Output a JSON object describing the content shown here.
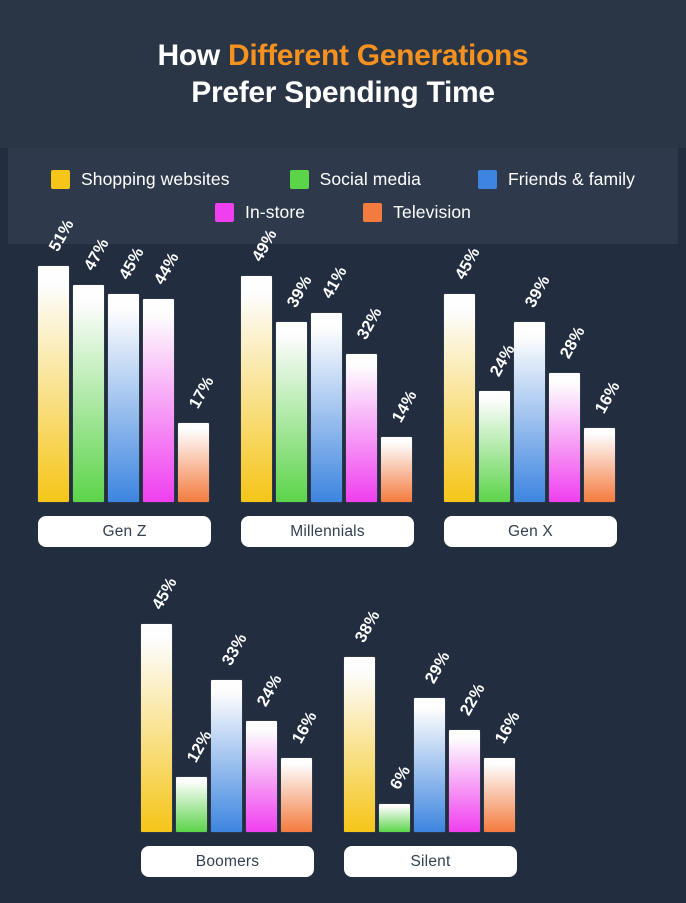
{
  "header": {
    "title_part1": "How ",
    "title_accent": "Different Generations",
    "title_line2": "Prefer Spending Time"
  },
  "legend": {
    "items": [
      {
        "label": "Shopping websites",
        "color": "#f5c518"
      },
      {
        "label": "Social media",
        "color": "#5cd44a"
      },
      {
        "label": "Friends & family",
        "color": "#3d85e0"
      },
      {
        "label": "In-store",
        "color": "#f03fef"
      },
      {
        "label": "Television",
        "color": "#f47b3f"
      }
    ]
  },
  "chart_data": {
    "type": "bar",
    "title": "How Different Generations Prefer Spending Time",
    "xlabel": "",
    "ylabel": "",
    "ylim": [
      0,
      55
    ],
    "grid": false,
    "legend_position": "top",
    "value_suffix": "%",
    "categories": [
      "Gen Z",
      "Millennials",
      "Gen X",
      "Boomers",
      "Silent"
    ],
    "series": [
      {
        "name": "Shopping websites",
        "color": "#f5c518",
        "values": [
          51,
          49,
          45,
          45,
          38
        ]
      },
      {
        "name": "Social media",
        "color": "#5cd44a",
        "values": [
          47,
          39,
          24,
          12,
          6
        ]
      },
      {
        "name": "Friends & family",
        "color": "#3d85e0",
        "values": [
          45,
          41,
          39,
          33,
          29
        ]
      },
      {
        "name": "In-store",
        "color": "#f03fef",
        "values": [
          44,
          32,
          28,
          24,
          22
        ]
      },
      {
        "name": "Television",
        "color": "#f47b3f",
        "values": [
          17,
          14,
          16,
          16,
          16
        ]
      }
    ],
    "groups": [
      {
        "label": "Gen Z",
        "labels": [
          "51%",
          "47%",
          "45%",
          "44%",
          "17%"
        ],
        "values": [
          51,
          47,
          45,
          44,
          17
        ]
      },
      {
        "label": "Millennials",
        "labels": [
          "49%",
          "39%",
          "41%",
          "32%",
          "14%"
        ],
        "values": [
          49,
          39,
          41,
          32,
          14
        ]
      },
      {
        "label": "Gen X",
        "labels": [
          "45%",
          "24%",
          "39%",
          "28%",
          "16%"
        ],
        "values": [
          45,
          24,
          39,
          28,
          16
        ]
      },
      {
        "label": "Boomers",
        "labels": [
          "45%",
          "12%",
          "33%",
          "24%",
          "16%"
        ],
        "values": [
          45,
          12,
          33,
          24,
          16
        ]
      },
      {
        "label": "Silent",
        "labels": [
          "38%",
          "6%",
          "29%",
          "22%",
          "16%"
        ],
        "values": [
          38,
          6,
          29,
          22,
          16
        ]
      }
    ]
  },
  "theme": {
    "background": "#222e3f",
    "header_background": "#2a3546",
    "legend_background": "#2e3a4b",
    "accent": "#f5911e",
    "text": "#ffffff",
    "pill_background": "#ffffff",
    "pill_text": "#32404f"
  }
}
